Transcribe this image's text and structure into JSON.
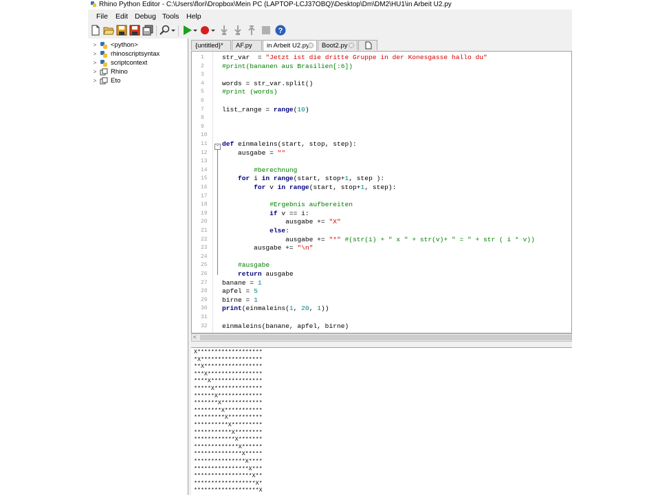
{
  "window": {
    "title": "Rhino Python Editor - C:\\Users\\flori\\Dropbox\\Mein PC (LAPTOP-LCJ37OBQ)\\Desktop\\Dm\\DM2\\HU1\\in Arbeit U2.py"
  },
  "menu": [
    "File",
    "Edit",
    "Debug",
    "Tools",
    "Help"
  ],
  "toolbar": [
    "new-file",
    "open-folder",
    "save",
    "save-as",
    "save-all",
    "find",
    "run",
    "breakpoint",
    "step-into",
    "step-over",
    "step-out",
    "stop",
    "help"
  ],
  "tree": [
    "<python>",
    "rhinoscriptsyntax",
    "scriptcontext",
    "Rhino",
    "Eto"
  ],
  "tabs": [
    "{untitled}*",
    "AF.py",
    "in Arbeit U2.py",
    "Boot2.py"
  ],
  "active_tab": 2,
  "code": [
    "str_var  = \"Jetzt ist die dritte Gruppe in der Konesgasse hallo du\"",
    "#print(bananen aus Brasilien[:6])",
    "",
    "words = str_var.split()",
    "#print (words)",
    "",
    "list_range = range(10)",
    "",
    "",
    "",
    "def einmaleins(start, stop, step):",
    "    ausgabe = \"\"",
    "",
    "        #berechnung",
    "    for i in range(start, stop+1, step ):",
    "        for v in range(start, stop+1, step):",
    "",
    "            #Ergebnis aufbereiten",
    "            if v == i:",
    "                ausgabe += \"X\"",
    "            else:",
    "                ausgabe += \"*\" #(str(i) + \" x \" + str(v)+ \" = \" + str ( i * v))",
    "        ausgabe += \"\\n\"",
    "",
    "    #ausgabe",
    "    return ausgabe",
    "banane = 1",
    "apfel = 5",
    "birne = 1",
    "print(einmaleins(1, 20, 1))",
    "",
    "einmaleins(banane, apfel, birne)"
  ],
  "output": [
    "X*******************",
    "*X******************",
    "**X*****************",
    "***X****************",
    "****X***************",
    "*****X**************",
    "******X*************",
    "*******X************",
    "********X***********",
    "*********X**********",
    "**********X*********",
    "***********X********",
    "************X*******",
    "*************X******",
    "**************X*****",
    "***************X****",
    "****************X***",
    "*****************X**",
    "******************X*",
    "*******************X"
  ],
  "colors": {
    "keyword": "#000080",
    "string": "#d40000",
    "comment": "#008000",
    "number": "#008080",
    "run_green": "#1aa01a",
    "breakpoint_red": "#d42020",
    "help_blue": "#2b5fb8"
  }
}
